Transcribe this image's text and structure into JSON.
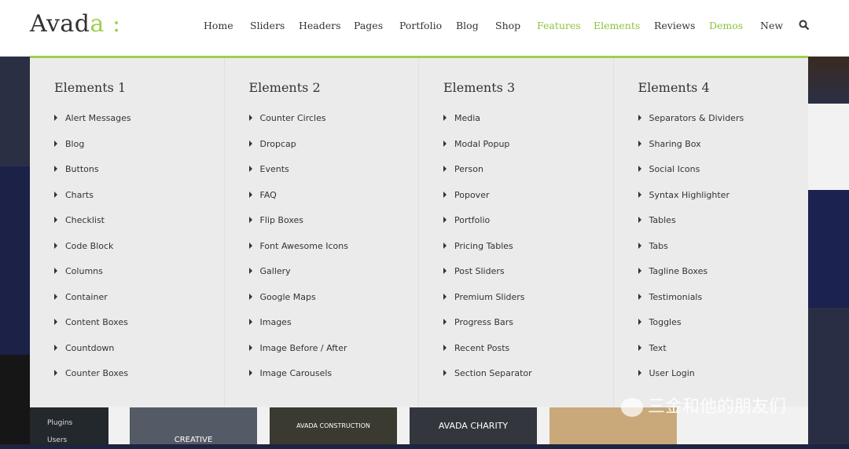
{
  "logo": {
    "text": "Avada",
    "accent": "a",
    "colon": ":"
  },
  "nav": [
    {
      "label": "Home"
    },
    {
      "label": "Sliders"
    },
    {
      "label": "Headers"
    },
    {
      "label": "Pages"
    },
    {
      "label": "Portfolio"
    },
    {
      "label": "Blog"
    },
    {
      "label": "Shop"
    },
    {
      "label": "Features",
      "active": true
    },
    {
      "label": "Elements",
      "active": true
    },
    {
      "label": "Reviews"
    },
    {
      "label": "Demos",
      "active": true
    },
    {
      "label": "New"
    }
  ],
  "colors": {
    "accent": "#a0ce4e",
    "panel": "#ebebeb"
  },
  "menu": [
    {
      "title": "Elements 1",
      "items": [
        "Alert Messages",
        "Blog",
        "Buttons",
        "Charts",
        "Checklist",
        "Code Block",
        "Columns",
        "Container",
        "Content Boxes",
        "Countdown",
        "Counter Boxes"
      ]
    },
    {
      "title": "Elements 2",
      "items": [
        "Counter Circles",
        "Dropcap",
        "Events",
        "FAQ",
        "Flip Boxes",
        "Font Awesome Icons",
        "Gallery",
        "Google Maps",
        "Images",
        "Image Before / After",
        "Image Carousels"
      ]
    },
    {
      "title": "Elements 3",
      "items": [
        "Media",
        "Modal Popup",
        "Person",
        "Popover",
        "Portfolio",
        "Pricing Tables",
        "Post Sliders",
        "Premium Sliders",
        "Progress Bars",
        "Recent Posts",
        "Section Separator"
      ]
    },
    {
      "title": "Elements 4",
      "items": [
        "Separators & Dividers",
        "Sharing Box",
        "Social Icons",
        "Syntax Highlighter",
        "Tables",
        "Tabs",
        "Tagline Boxes",
        "Testimonials",
        "Toggles",
        "Text",
        "User Login"
      ]
    }
  ],
  "background": {
    "admin": [
      "Plugins",
      "Users"
    ],
    "thumbs": [
      "CREATIVE",
      "AVADA CONSTRUCTION",
      "AVADA CHARITY"
    ]
  },
  "watermark": "三金和他的朋友们"
}
